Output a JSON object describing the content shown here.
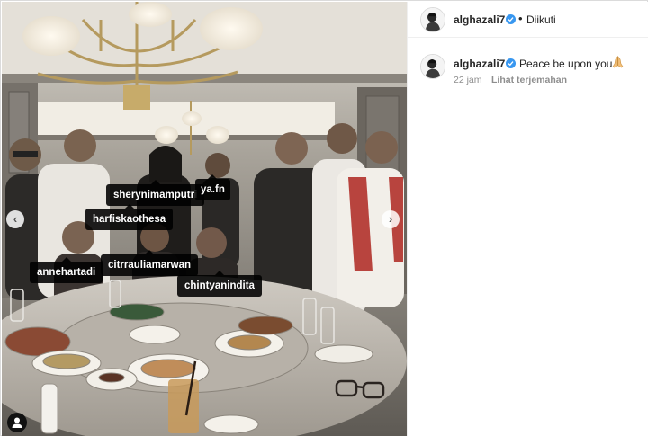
{
  "post": {
    "username": "alghazali7",
    "follow_status": "Diikuti",
    "separator": "•",
    "verified_color": "#3897f0",
    "photo_tags": [
      "sherynimamputri",
      "ya.fn",
      "harfiskaothesa",
      "annehartadi",
      "citrrauliamarwan",
      "chintyanindita"
    ],
    "nav": {
      "prev_icon": "‹",
      "next_icon": "›"
    },
    "tagged_icon": "person-icon"
  },
  "comment": {
    "username": "alghazali7",
    "text": "Peace be upon you",
    "emoji_icon": "praying-hands-icon",
    "time": "22 jam",
    "translate_label": "Lihat terjemahan"
  }
}
